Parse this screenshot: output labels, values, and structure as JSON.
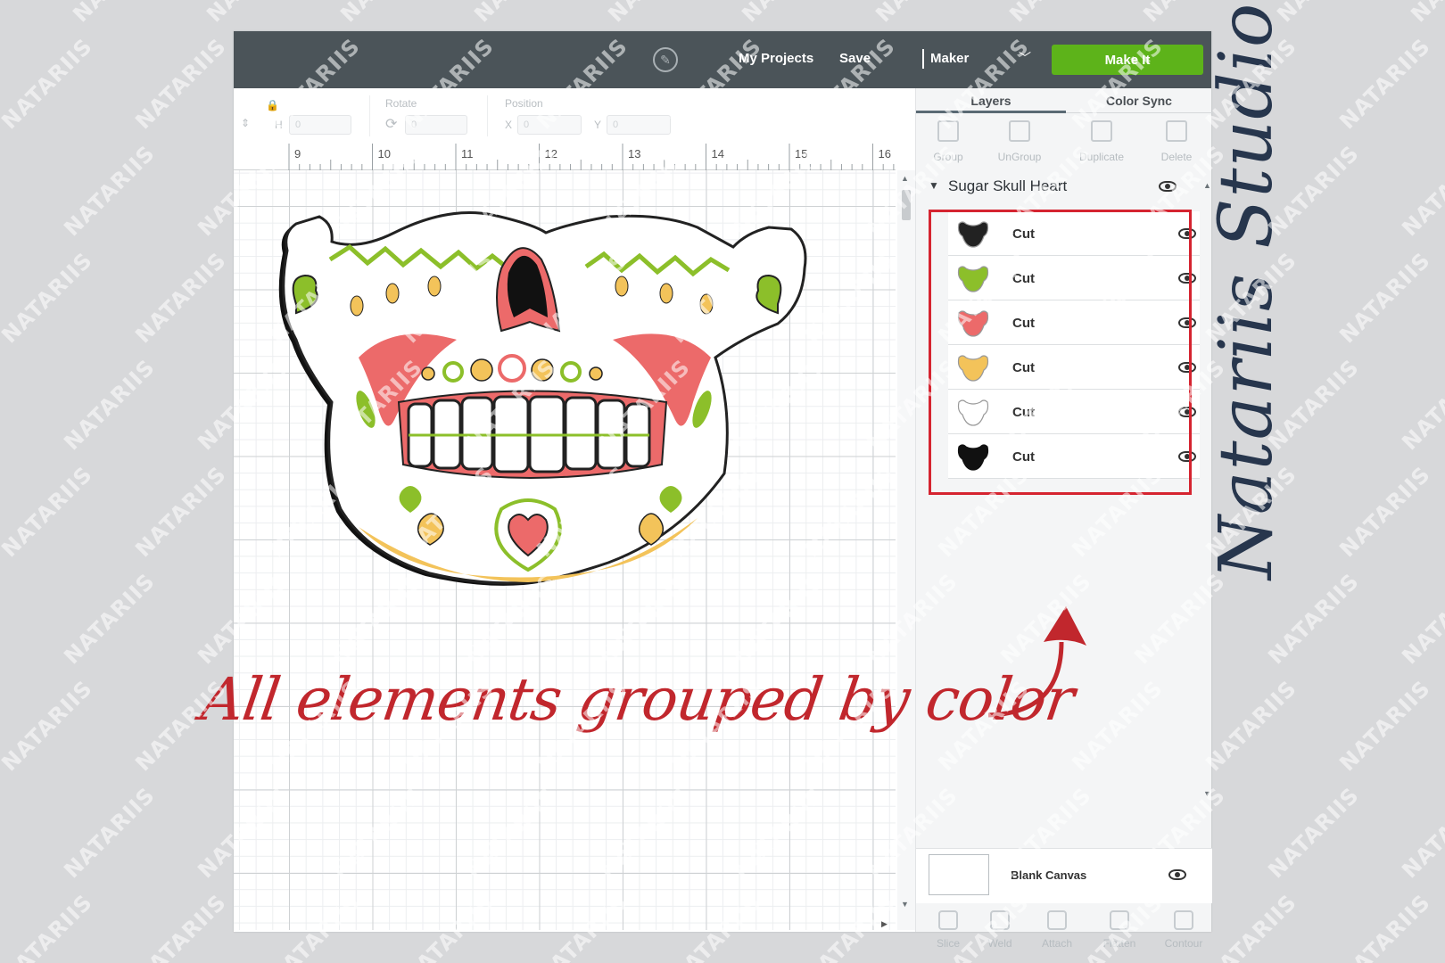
{
  "topbar": {
    "my_projects": "My Projects",
    "save": "Save",
    "machine": "Maker",
    "make_it": "Make It"
  },
  "editbar": {
    "h_label": "H",
    "h_value": "0",
    "rotate_label": "Rotate",
    "rotate_value": "0",
    "position_label": "Position",
    "x_label": "X",
    "x_value": "0",
    "y_label": "Y",
    "y_value": "0"
  },
  "ruler": {
    "ticks": [
      "9",
      "10",
      "11",
      "12",
      "13",
      "14",
      "15",
      "16"
    ]
  },
  "panel": {
    "tabs": [
      "Layers",
      "Color Sync"
    ],
    "tools": [
      "Group",
      "UnGroup",
      "Duplicate",
      "Delete"
    ],
    "group_name": "Sugar Skull Heart",
    "layers": [
      {
        "label": "Cut",
        "thumb_color": "#222222"
      },
      {
        "label": "Cut",
        "thumb_color": "#8cbf2a"
      },
      {
        "label": "Cut",
        "thumb_color": "#ec6a6a"
      },
      {
        "label": "Cut",
        "thumb_color": "#f3c35a"
      },
      {
        "label": "Cut",
        "thumb_color": "#f2f2f2"
      },
      {
        "label": "Cut",
        "thumb_color": "#111111"
      }
    ],
    "blank_canvas": "Blank Canvas",
    "bottom_tools": [
      "Slice",
      "Weld",
      "Attach",
      "Flatten",
      "Contour"
    ]
  },
  "annotation": {
    "caption": "All elements grouped by color",
    "brand": "Natariis Studio",
    "watermark": "NATARIIS"
  },
  "colors": {
    "topbar": "#4b5459",
    "make_it": "#5db31a",
    "highlight": "#d52430",
    "caption": "#c1272d",
    "brand": "#27364d"
  }
}
